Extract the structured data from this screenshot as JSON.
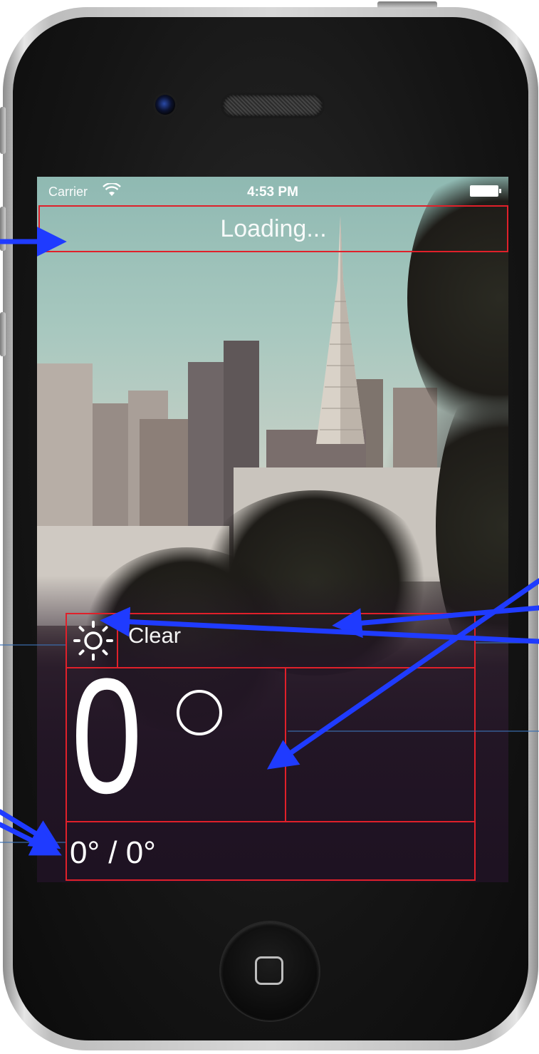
{
  "status_bar": {
    "carrier": "Carrier",
    "time": "4:53 PM"
  },
  "weather": {
    "city": "Loading...",
    "condition_icon": "sun-icon",
    "condition": "Clear",
    "temperature": "0",
    "hi_lo": "0° / 0°"
  },
  "colors": {
    "annotation_box": "#e0202a",
    "annotation_arrow": "#1f3bff",
    "guide_line": "#3b6fb0"
  },
  "icons": [
    "wifi-icon",
    "battery-icon",
    "sun-icon",
    "home-button-icon"
  ]
}
